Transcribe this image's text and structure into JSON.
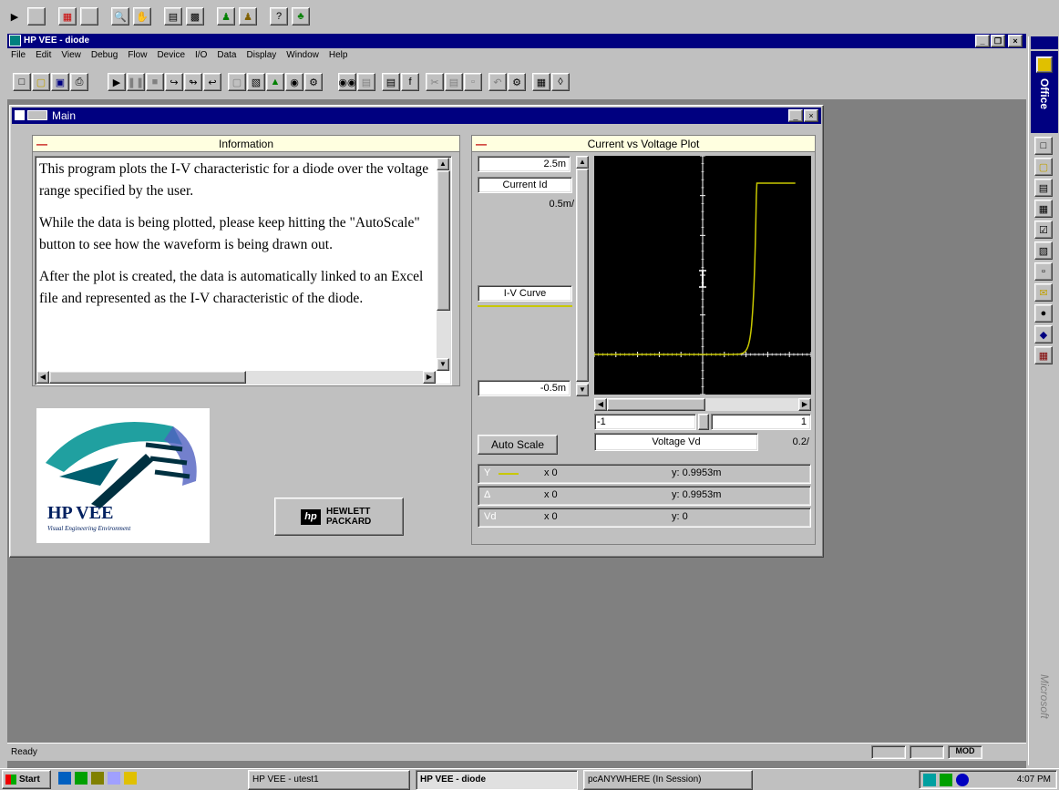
{
  "app": {
    "title": "HP VEE - diode",
    "menu": [
      "File",
      "Edit",
      "View",
      "Debug",
      "Flow",
      "Device",
      "I/O",
      "Data",
      "Display",
      "Window",
      "Help"
    ],
    "status": "Ready",
    "status_indicators": [
      "",
      "",
      "MOD"
    ]
  },
  "main_window": {
    "title": "Main"
  },
  "info_panel": {
    "title": "Information",
    "paragraphs": [
      "This program plots the I-V characteristic for a diode over the voltage range specified by the user.",
      "While the data is being plotted, please keep hitting the \"AutoScale\" button to see how the waveform is being drawn out.",
      "After the plot is created, the data is automatically linked to an Excel file and represented as the I-V characteristic of the diode."
    ]
  },
  "plot_panel": {
    "title": "Current vs Voltage Plot",
    "y_max": "2.5m",
    "y_label": "Current Id",
    "y_div": "0.5m/",
    "trace_label": "I-V Curve",
    "y_min": "-0.5m",
    "x_min": "-1",
    "x_max": "1",
    "x_label": "Voltage Vd",
    "x_div": "0.2/",
    "autoscale": "Auto Scale",
    "markers": [
      {
        "name": "Y",
        "x": "x 0",
        "y": "y: 0.9953m"
      },
      {
        "name": "Δ",
        "x": "x 0",
        "y": "y: 0.9953m"
      },
      {
        "name": "Vd",
        "x": "x 0",
        "y": "y: 0"
      }
    ],
    "colors": {
      "background": "#000000",
      "trace": "#c8c800",
      "grid": "#ffffff"
    }
  },
  "logos": {
    "hpvee": "HP VEE",
    "hpvee_tagline": "Visual Engineering Environment",
    "hp_line1": "HEWLETT",
    "hp_line2": "PACKARD"
  },
  "office_bar": {
    "title": "Office",
    "vendor": "Microsoft"
  },
  "taskbar": {
    "start": "Start",
    "tasks": [
      "HP VEE - utest1",
      "HP VEE - diode",
      "pcANYWHERE (In Session)"
    ],
    "clock": "4:07 PM"
  }
}
